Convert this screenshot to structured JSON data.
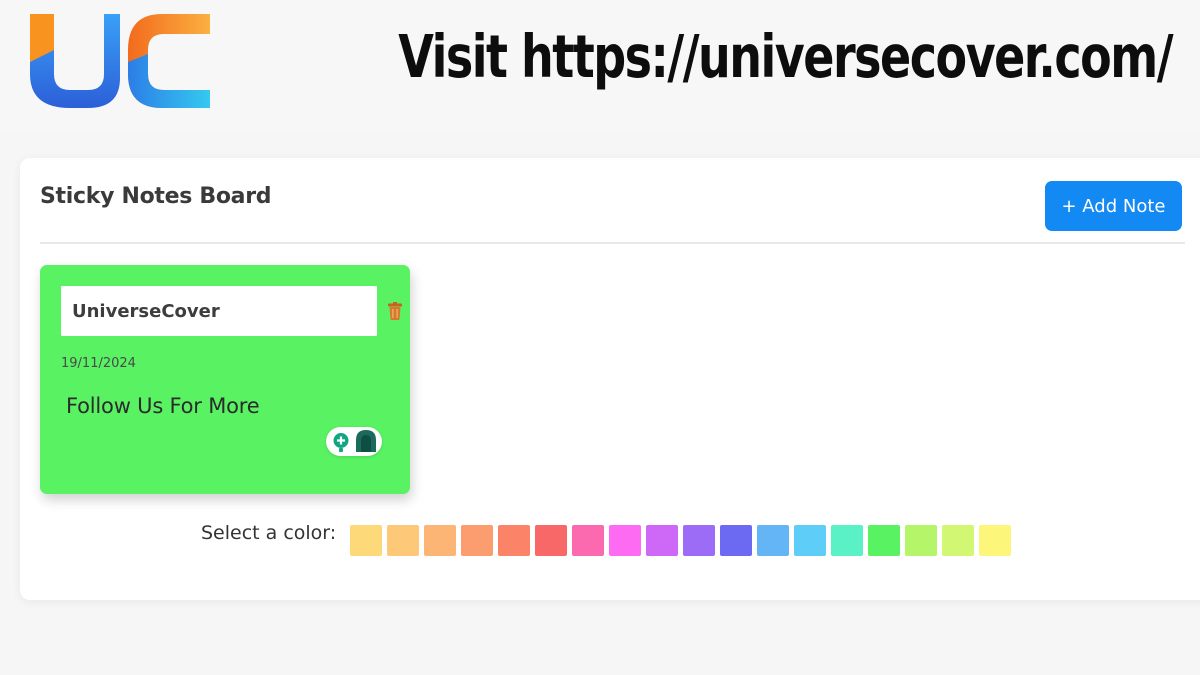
{
  "banner": {
    "logo_letters": "UC",
    "visit_text": "Visit https://universecover.com/"
  },
  "board": {
    "title": "Sticky Notes Board",
    "add_note_label": "+ Add Note"
  },
  "notes": [
    {
      "title": "UniverseCover",
      "date": "19/11/2024",
      "body": "Follow Us For More",
      "color": "#59f263"
    }
  ],
  "color_picker": {
    "label": "Select a color:",
    "colors": [
      "#fed97a",
      "#fdc978",
      "#fcb574",
      "#fb9d6e",
      "#fb8468",
      "#f86868",
      "#fb6aae",
      "#fc6bf2",
      "#cd69f6",
      "#9c6cf6",
      "#6c6af3",
      "#64b5f6",
      "#5ecdf7",
      "#5bf1c7",
      "#59f263",
      "#b5f569",
      "#d2f773",
      "#fcf77a"
    ]
  },
  "icons": {
    "delete": "trash-icon",
    "grammar": "grammar-assistant-icon"
  },
  "colors": {
    "accent": "#1389f4",
    "logo_blue": "#2f7be9",
    "logo_orange": "#f7931e"
  }
}
